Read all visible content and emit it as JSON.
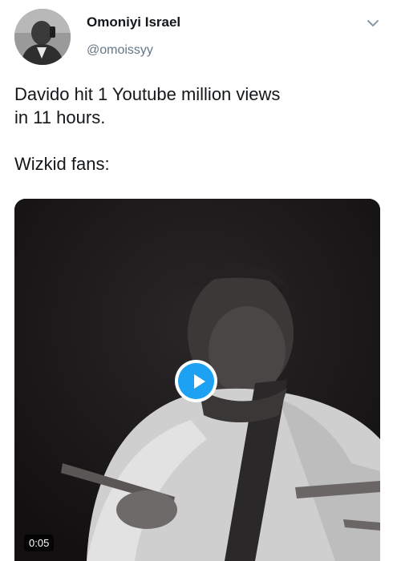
{
  "tweet": {
    "author": {
      "display_name": "Omoniyi Israel",
      "handle": "@omoissyy",
      "avatar_icon": "profile-photo"
    },
    "text": {
      "line1": "Davido hit 1 Youtube million views",
      "line2": "in 11 hours.",
      "line3": "Wizkid fans:"
    },
    "media": {
      "type": "video",
      "play_icon": "play-icon",
      "duration": "0:05",
      "accent_color": "#1da1f2"
    },
    "menu_icon": "chevron-down-icon"
  }
}
